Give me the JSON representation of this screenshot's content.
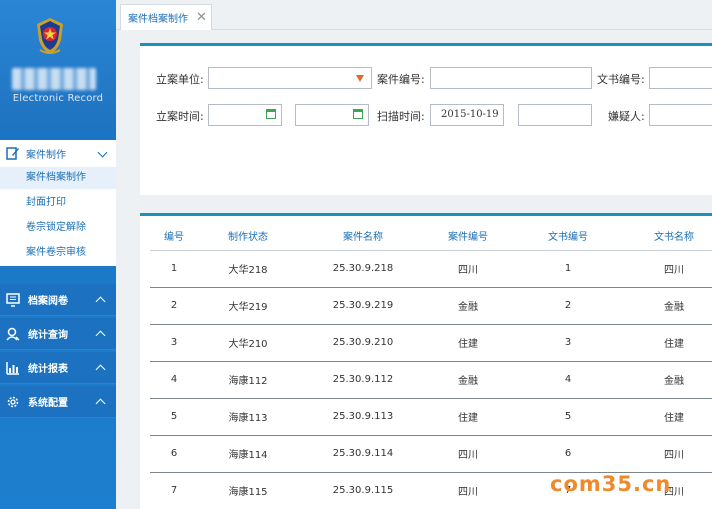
{
  "logo": {
    "subtitle": "Electronic Record"
  },
  "sidebar": {
    "active_group": {
      "label": "案件制作",
      "items": [
        {
          "label": "案件档案制作"
        },
        {
          "label": "封面打印"
        },
        {
          "label": "卷宗锁定解除"
        },
        {
          "label": "案件卷宗审核"
        }
      ]
    },
    "groups": [
      {
        "label": "档案阅卷"
      },
      {
        "label": "统计查询"
      },
      {
        "label": "统计报表"
      },
      {
        "label": "系统配置"
      }
    ]
  },
  "tabs": [
    {
      "label": "案件档案制作"
    }
  ],
  "search": {
    "unit_label": "立案单位:",
    "unit_value": "",
    "case_no_label": "案件编号:",
    "case_no_value": "",
    "doc_no_label": "文书编号:",
    "doc_no_value": "",
    "filed_time_label": "立案时间:",
    "filed_start": "",
    "filed_end": "",
    "scan_time_label": "扫描时间:",
    "scan_start": "2015-10-19",
    "scan_end": "",
    "suspect_label": "嫌疑人:",
    "suspect_value": ""
  },
  "table": {
    "headers": [
      "编号",
      "制作状态",
      "案件名称",
      "案件编号",
      "文书编号",
      "文书名称"
    ],
    "rows": [
      [
        "1",
        "大华218",
        "25.30.9.218",
        "四川",
        "1",
        "四川"
      ],
      [
        "2",
        "大华219",
        "25.30.9.219",
        "金融",
        "2",
        "金融"
      ],
      [
        "3",
        "大华210",
        "25.30.9.210",
        "住建",
        "3",
        "住建"
      ],
      [
        "4",
        "海康112",
        "25.30.9.112",
        "金融",
        "4",
        "金融"
      ],
      [
        "5",
        "海康113",
        "25.30.9.113",
        "住建",
        "5",
        "住建"
      ],
      [
        "6",
        "海康114",
        "25.30.9.114",
        "四川",
        "6",
        "四川"
      ],
      [
        "7",
        "海康115",
        "25.30.9.115",
        "四川",
        "7",
        "四川"
      ]
    ]
  },
  "watermark": "com35.cn",
  "colors": {
    "accent": "#1a6fb8",
    "sidebar": "#1c72c0",
    "panel_border": "#1b8fbd",
    "watermark": "#ef8a2a",
    "calendar": "#3fa554"
  }
}
